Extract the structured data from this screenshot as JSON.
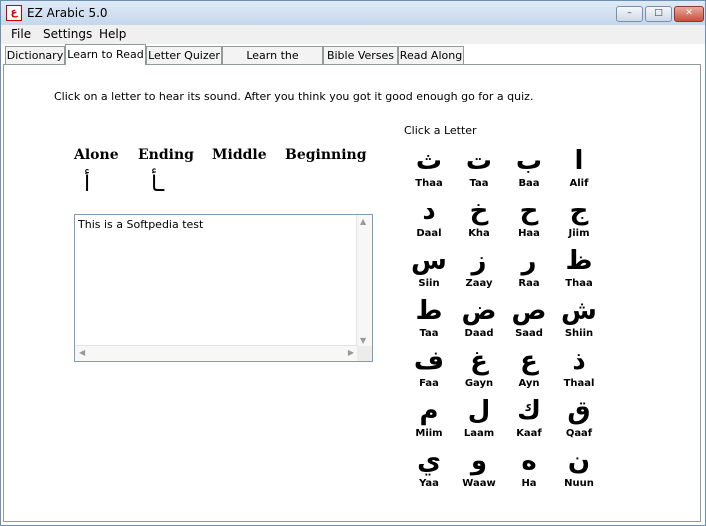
{
  "window": {
    "title": "EZ Arabic 5.0",
    "app_icon": "ع",
    "minimize_glyph": "–",
    "maximize_glyph": "□",
    "close_glyph": "✕"
  },
  "menu": [
    "File",
    "Settings",
    "Help"
  ],
  "tabs": [
    {
      "label": "Dictionary"
    },
    {
      "label": "Learn to Read",
      "active": true
    },
    {
      "label": "Letter Quizer"
    },
    {
      "label": "Learn the numbers"
    },
    {
      "label": "Bible Verses"
    },
    {
      "label": "Read Along"
    }
  ],
  "learn": {
    "instructions": "Click on a letter to hear its sound. After you think you got it good enough go for a quiz.",
    "headers": [
      "Alone",
      "Ending",
      "Middle",
      "Beginning"
    ],
    "forms": [
      "أ",
      "ـأ",
      "",
      ""
    ],
    "textbox_text": "This is a Softpedia test",
    "click_label": "Click a Letter"
  },
  "letters": [
    {
      "glyph": "ث",
      "name": "Thaa"
    },
    {
      "glyph": "ت",
      "name": "Taa"
    },
    {
      "glyph": "ب",
      "name": "Baa"
    },
    {
      "glyph": "ا",
      "name": "Alif"
    },
    {
      "glyph": "د",
      "name": "Daal"
    },
    {
      "glyph": "خ",
      "name": "Kha"
    },
    {
      "glyph": "ح",
      "name": "Haa"
    },
    {
      "glyph": "ج",
      "name": "Jiim"
    },
    {
      "glyph": "س",
      "name": "Siin"
    },
    {
      "glyph": "ز",
      "name": "Zaay"
    },
    {
      "glyph": "ر",
      "name": "Raa"
    },
    {
      "glyph": "ظ",
      "name": "Thaa"
    },
    {
      "glyph": "ط",
      "name": "Taa"
    },
    {
      "glyph": "ض",
      "name": "Daad"
    },
    {
      "glyph": "ص",
      "name": "Saad"
    },
    {
      "glyph": "ش",
      "name": "Shiin"
    },
    {
      "glyph": "ف",
      "name": "Faa"
    },
    {
      "glyph": "غ",
      "name": "Gayn"
    },
    {
      "glyph": "ع",
      "name": "Ayn"
    },
    {
      "glyph": "ذ",
      "name": "Thaal"
    },
    {
      "glyph": "م",
      "name": "Miim"
    },
    {
      "glyph": "ل",
      "name": "Laam"
    },
    {
      "glyph": "ك",
      "name": "Kaaf"
    },
    {
      "glyph": "ق",
      "name": "Qaaf"
    },
    {
      "glyph": "ي",
      "name": "Yaa"
    },
    {
      "glyph": "و",
      "name": "Waaw"
    },
    {
      "glyph": "ه",
      "name": "Ha"
    },
    {
      "glyph": "ن",
      "name": "Nuun"
    }
  ]
}
